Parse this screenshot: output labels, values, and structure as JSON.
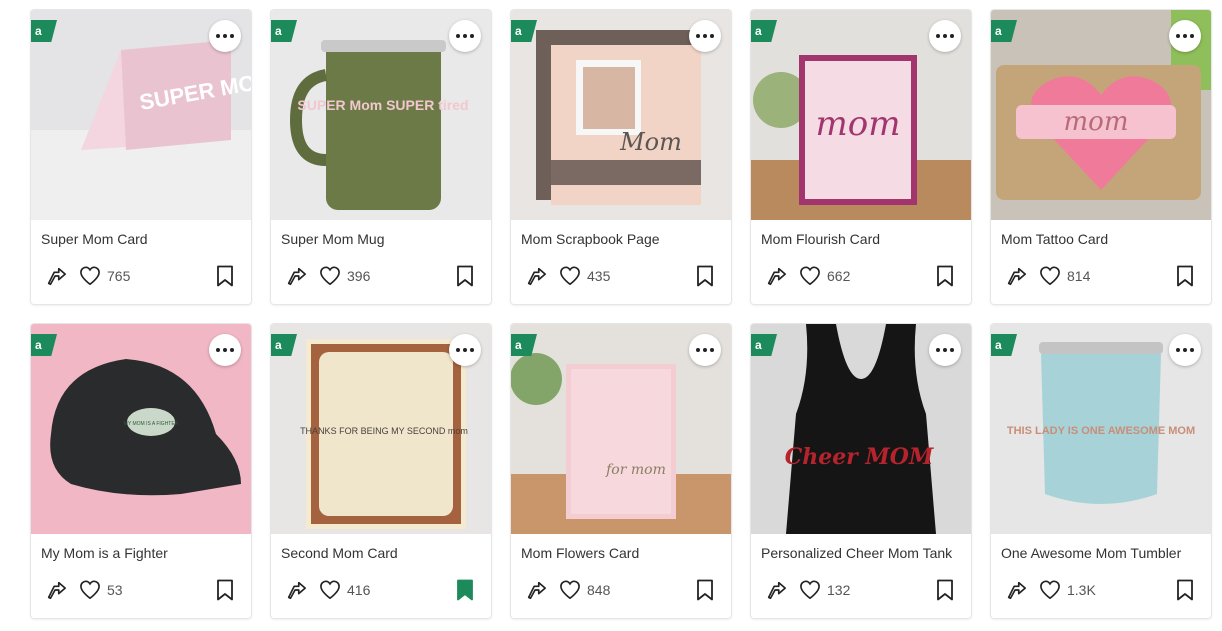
{
  "colors": {
    "access_badge": "#1d8a5b",
    "bookmark_saved": "#1d8a5b",
    "card_border": "#e6e6e6",
    "text": "#333333"
  },
  "badge_letter": "a",
  "projects": [
    {
      "title": "Super Mom Card",
      "likes": "765",
      "saved": false,
      "thumb_text": "SUPER MOM"
    },
    {
      "title": "Super Mom Mug",
      "likes": "396",
      "saved": false,
      "thumb_text": "SUPER Mom SUPER tired"
    },
    {
      "title": "Mom Scrapbook Page",
      "likes": "435",
      "saved": false,
      "thumb_text": "Mom"
    },
    {
      "title": "Mom Flourish Card",
      "likes": "662",
      "saved": false,
      "thumb_text": "mom"
    },
    {
      "title": "Mom Tattoo Card",
      "likes": "814",
      "saved": false,
      "thumb_text": "mom"
    },
    {
      "title": "My Mom is a Fighter",
      "likes": "53",
      "saved": false,
      "thumb_text": "MY MOM IS A FIGHTER"
    },
    {
      "title": "Second Mom Card",
      "likes": "416",
      "saved": true,
      "thumb_text": "THANKS FOR BEING MY SECOND mom"
    },
    {
      "title": "Mom Flowers Card",
      "likes": "848",
      "saved": false,
      "thumb_text": "for mom"
    },
    {
      "title": "Personalized Cheer Mom Tank",
      "likes": "132",
      "saved": false,
      "thumb_text": "Cheer MOM"
    },
    {
      "title": "One Awesome Mom Tumbler",
      "likes": "1.3K",
      "saved": false,
      "thumb_text": "THIS LADY IS ONE AWESOME MOM"
    }
  ]
}
